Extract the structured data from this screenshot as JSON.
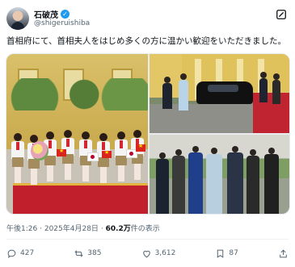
{
  "author": {
    "name": "石破茂",
    "handle": "@shigeruishiba"
  },
  "post": {
    "text": "首相府にて、首相夫人をはじめ多くの方に温かい歓迎をいただきました。"
  },
  "meta": {
    "time": "午後1:26",
    "date": "2025年4月28日",
    "views": "60.2万",
    "views_suffix": "件の表示",
    "separator": "·"
  },
  "actions": {
    "replies": "427",
    "reposts": "385",
    "likes": "3,612",
    "bookmarks": "87"
  },
  "colors": {
    "verified": "#1d9bf0",
    "text": "#0f1419",
    "secondary": "#536471"
  },
  "icons": [
    "verified-badge-icon",
    "grok-icon",
    "reply-icon",
    "repost-icon",
    "like-icon",
    "bookmark-icon",
    "share-icon"
  ]
}
